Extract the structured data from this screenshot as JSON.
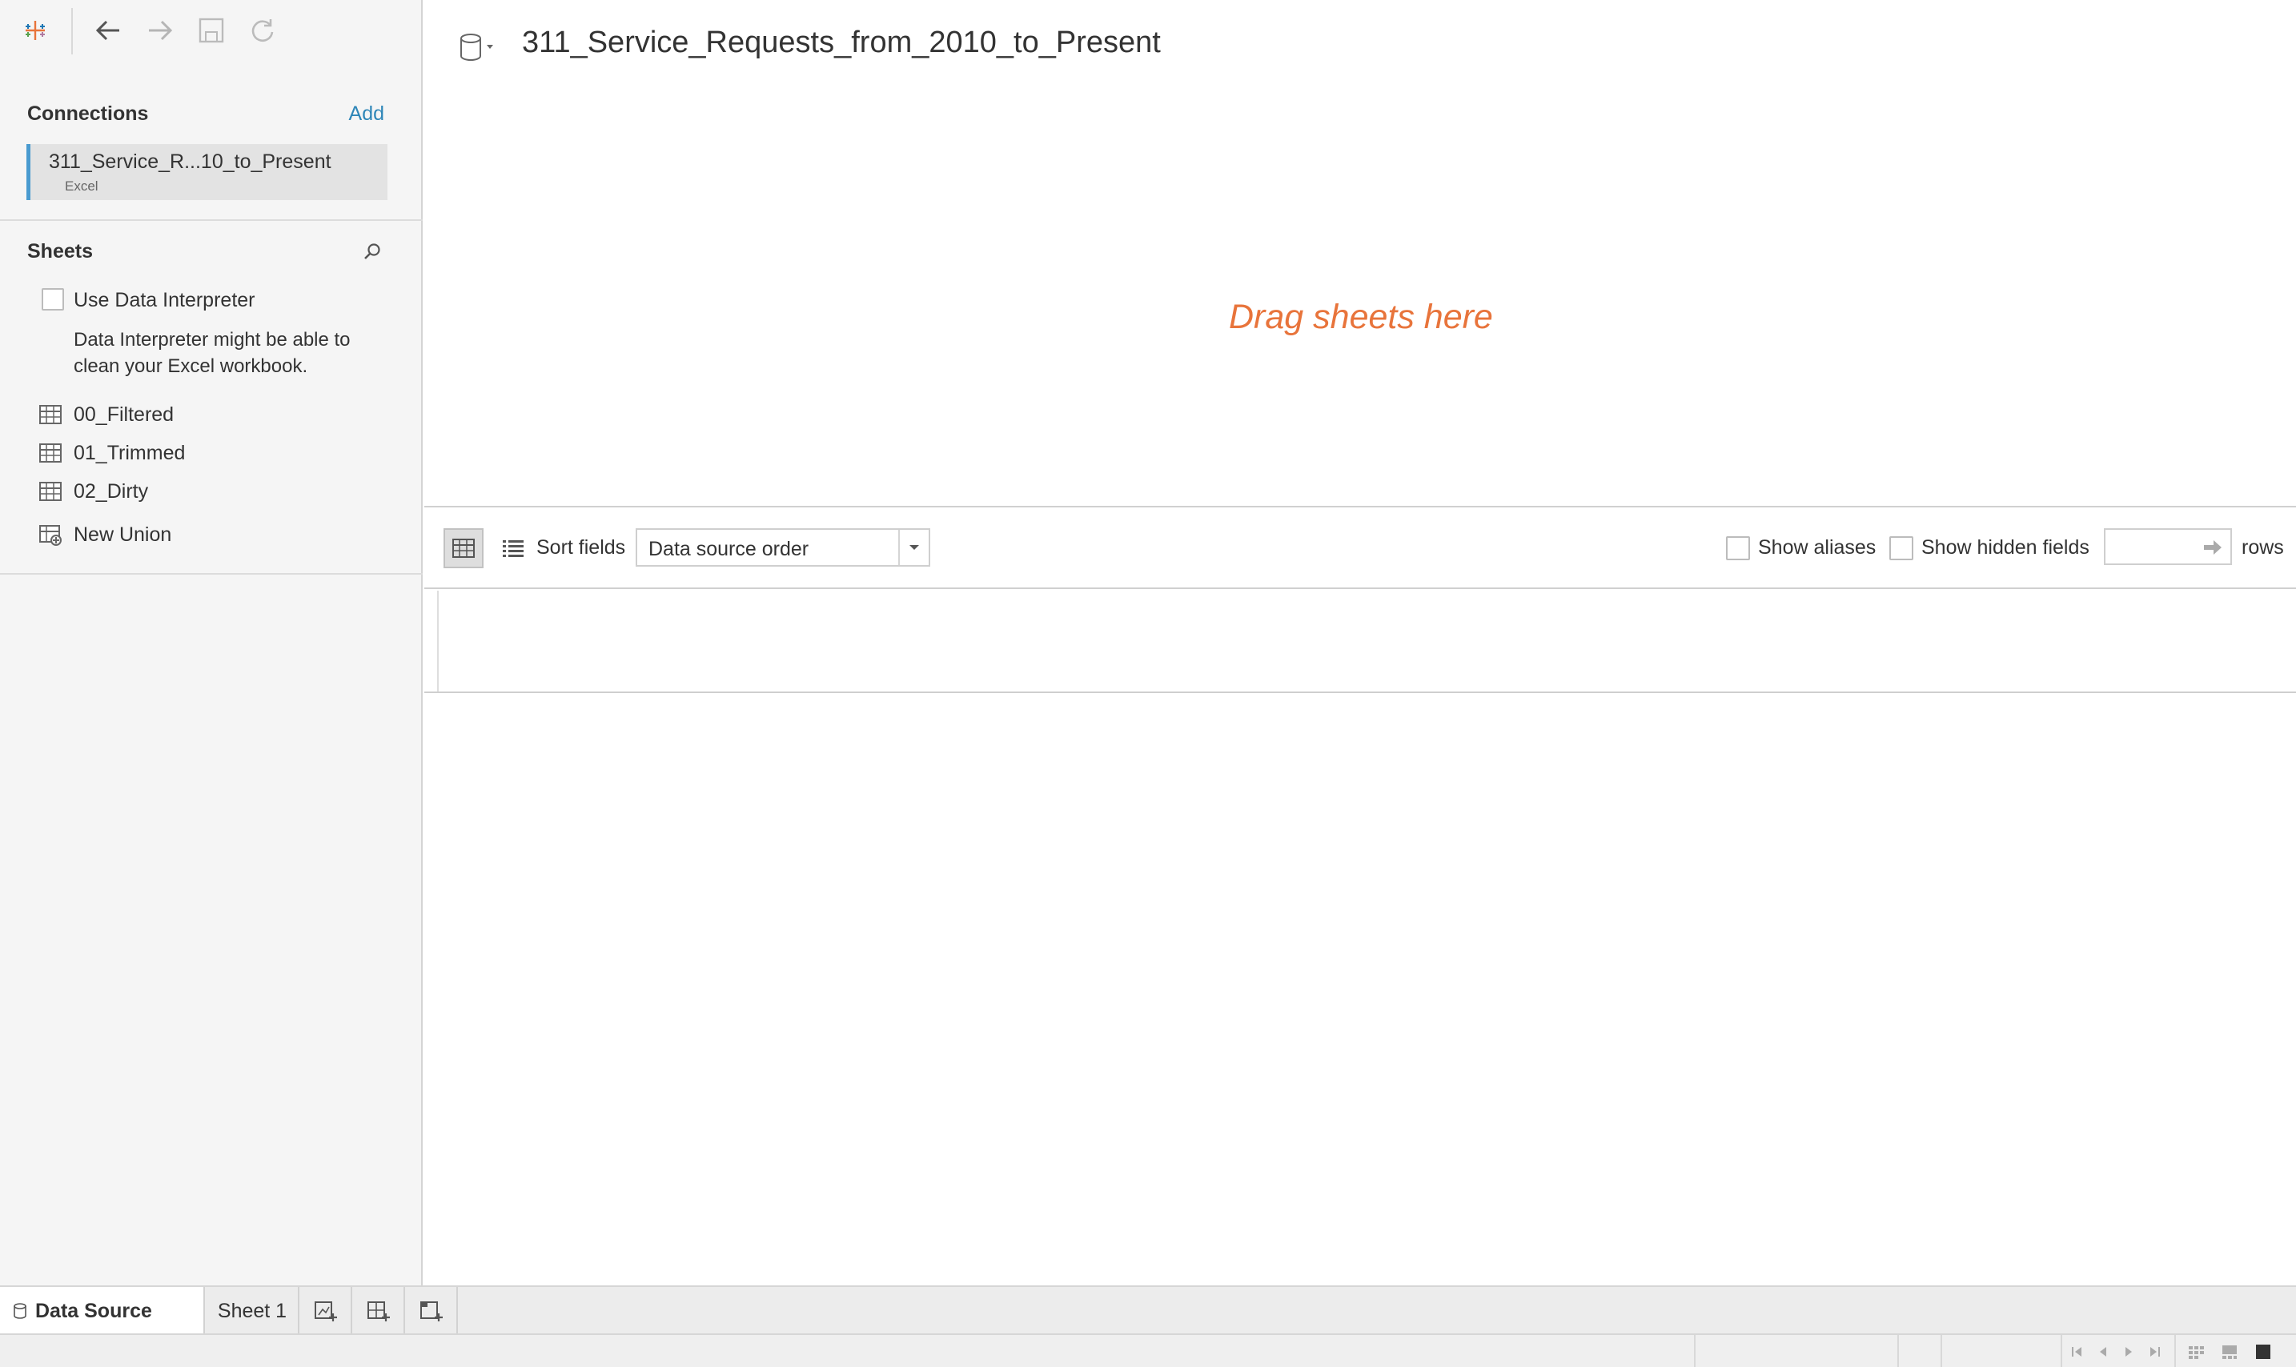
{
  "toolbar": {
    "logo_icon": "tableau-logo-icon",
    "back_icon": "arrow-left-icon",
    "forward_icon": "arrow-right-icon",
    "save_icon": "save-icon",
    "refresh_icon": "refresh-icon"
  },
  "connections": {
    "title": "Connections",
    "add_label": "Add",
    "items": [
      {
        "name": "311_Service_R...10_to_Present",
        "type": "Excel"
      }
    ]
  },
  "sheets": {
    "title": "Sheets",
    "data_interpreter": {
      "label": "Use Data Interpreter",
      "checked": false,
      "hint": "Data Interpreter might be able to clean your Excel workbook."
    },
    "items": [
      {
        "label": "00_Filtered",
        "icon": "table-icon"
      },
      {
        "label": "01_Trimmed",
        "icon": "table-icon"
      },
      {
        "label": "02_Dirty",
        "icon": "table-icon"
      },
      {
        "label": "New Union",
        "icon": "union-icon"
      }
    ]
  },
  "canvas": {
    "datasource_title": "311_Service_Requests_from_2010_to_Present",
    "drag_hint": "Drag sheets here"
  },
  "grid_toolbar": {
    "sort_label": "Sort fields",
    "sort_value": "Data source order",
    "show_aliases_label": "Show aliases",
    "show_aliases_checked": false,
    "show_hidden_label": "Show hidden fields",
    "show_hidden_checked": false,
    "rows_value": "",
    "rows_label": "rows"
  },
  "tabs": {
    "data_source_label": "Data Source",
    "sheet1_label": "Sheet 1",
    "new_worksheet_icon": "new-worksheet-icon",
    "new_dashboard_icon": "new-dashboard-icon",
    "new_story_icon": "new-story-icon"
  },
  "colors": {
    "accent": "#2e86b8",
    "drag_hint": "#e8743b",
    "connection_bar": "#4a9bd0"
  }
}
